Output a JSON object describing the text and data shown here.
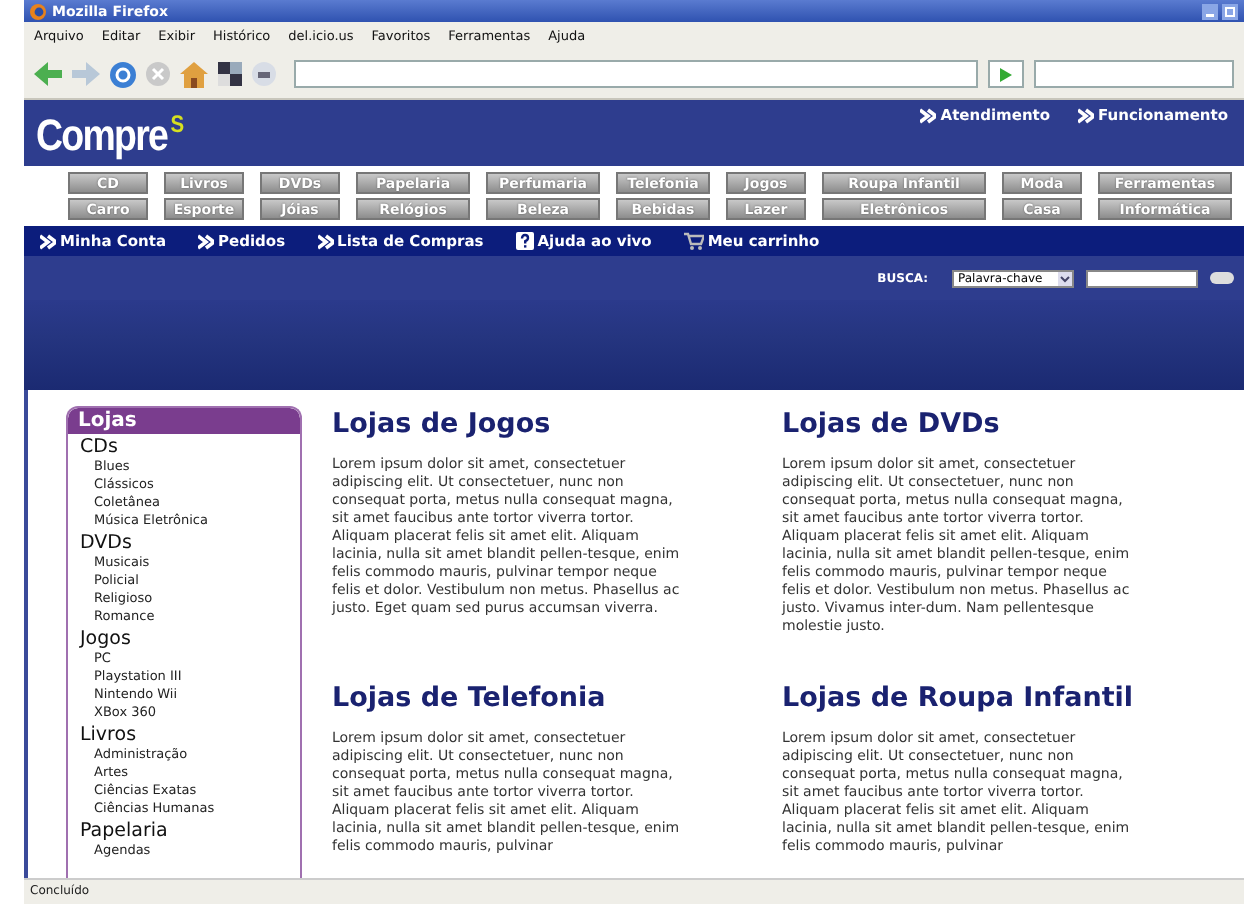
{
  "window": {
    "title": "Mozilla Firefox"
  },
  "menu": [
    "Arquivo",
    "Editar",
    "Exibir",
    "Histórico",
    "del.icio.us",
    "Favoritos",
    "Ferramentas",
    "Ajuda"
  ],
  "site": {
    "logo": "Compre",
    "logo_mark": "S",
    "top_links": [
      "Atendimento",
      "Funcionamento"
    ],
    "categories": [
      [
        "CD",
        "Livros",
        "DVDs",
        "Papelaria",
        "Perfumaria",
        "Telefonia",
        "Jogos",
        "Roupa Infantil",
        "Moda",
        "Ferramentas"
      ],
      [
        "Carro",
        "Esporte",
        "Jóias",
        "Relógios",
        "Beleza",
        "Bebidas",
        "Lazer",
        "Eletrônicos",
        "Casa",
        "Informática"
      ]
    ],
    "account_links": [
      {
        "label": "Minha Conta",
        "kind": "chevrons"
      },
      {
        "label": "Pedidos",
        "kind": "chevrons"
      },
      {
        "label": "Lista de Compras",
        "kind": "chevrons"
      },
      {
        "label": "Ajuda ao vivo",
        "kind": "help"
      },
      {
        "label": "Meu carrinho",
        "kind": "cart"
      }
    ],
    "search": {
      "label": "BUSCA:",
      "select": "Palavra-chave"
    }
  },
  "sidebar": {
    "title": "Lojas",
    "groups": [
      {
        "label": "CDs",
        "children": [
          "Blues",
          "Clássicos",
          "Coletânea",
          "Música Eletrônica"
        ]
      },
      {
        "label": "DVDs",
        "children": [
          "Musicais",
          "Policial",
          "Religioso",
          "Romance"
        ]
      },
      {
        "label": "Jogos",
        "children": [
          "PC",
          "Playstation III",
          "Nintendo Wii",
          "XBox 360"
        ]
      },
      {
        "label": "Livros",
        "children": [
          "Administração",
          "Artes",
          "Ciências Exatas",
          "Ciências Humanas"
        ]
      },
      {
        "label": "Papelaria",
        "children": [
          "Agendas"
        ]
      }
    ]
  },
  "stores": [
    {
      "title": "Lojas de Jogos",
      "text": "Lorem ipsum dolor sit amet, consectetuer adipiscing elit. Ut consectetuer, nunc non consequat porta, metus nulla consequat magna, sit amet faucibus ante tortor viverra tortor. Aliquam placerat felis sit amet elit. Aliquam lacinia, nulla sit amet blandit pellen-tesque, enim felis commodo mauris, pulvinar tempor neque felis et dolor. Vestibulum non metus. Phasellus ac justo. Eget quam sed purus accumsan viverra."
    },
    {
      "title": "Lojas de DVDs",
      "text": "Lorem ipsum dolor sit amet, consectetuer adipiscing elit. Ut consectetuer, nunc non consequat porta, metus nulla consequat magna, sit amet faucibus ante tortor viverra tortor. Aliquam placerat felis sit amet elit. Aliquam lacinia, nulla sit amet blandit pellen-tesque, enim felis commodo mauris, pulvinar tempor neque felis et dolor. Vestibulum non metus. Phasellus ac justo. Vivamus inter-dum. Nam pellentesque molestie justo."
    },
    {
      "title": "Lojas de Telefonia",
      "text": "Lorem ipsum dolor sit amet, consectetuer adipiscing elit. Ut consectetuer, nunc non consequat porta, metus nulla consequat magna, sit amet faucibus ante tortor viverra tortor. Aliquam placerat felis sit amet elit. Aliquam lacinia, nulla sit amet blandit pellen-tesque, enim felis commodo mauris, pulvinar"
    },
    {
      "title": "Lojas de Roupa Infantil",
      "text": "Lorem ipsum dolor sit amet, consectetuer adipiscing elit. Ut consectetuer, nunc non consequat porta, metus nulla consequat magna, sit amet faucibus ante tortor viverra tortor. Aliquam placerat felis sit amet elit. Aliquam lacinia, nulla sit amet blandit pellen-tesque, enim felis commodo mauris, pulvinar"
    }
  ],
  "status_bar": "Concluído"
}
